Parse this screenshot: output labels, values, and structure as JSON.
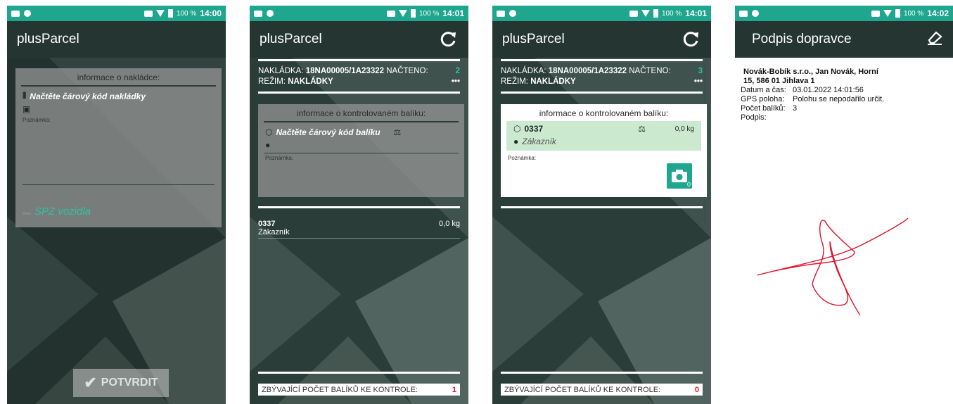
{
  "colors": {
    "accent": "#1fa68e",
    "dark": "#253632",
    "danger": "#e0132a"
  },
  "screens": [
    {
      "status": {
        "battery": "100 %",
        "time": "14:00"
      },
      "app_title": "plusParcel",
      "panel_heading": "informace o nakládce:",
      "scan_prompt": "Načtěte čárový kód nakládky",
      "note_label": "Poznámka:",
      "vehicle_placeholder": "SPZ vozidla",
      "confirm_label": "POTVRDIT",
      "icons": {
        "scan": "barcode-icon",
        "calendar": "calendar-icon",
        "truck": "truck-icon",
        "confirm": "check-icon"
      }
    },
    {
      "status": {
        "battery": "100 %",
        "time": "14:01"
      },
      "app_title": "plusParcel",
      "loading_label": "NAKLÁDKA:",
      "loading_code": "18NA00005/1A23322",
      "loaded_label": "NAČTENO:",
      "loaded_count": "2",
      "mode_label": "REŽIM:",
      "mode_value": "NAKLÁDKY",
      "more": "•••",
      "panel_heading": "informace o kontrolovaném balíku:",
      "scan_prompt": "Načtěte čárový kód balíku",
      "note_label": "Poznámka:",
      "list": [
        {
          "code": "0337",
          "weight": "0,0 kg",
          "customer": "Zákazník"
        }
      ],
      "remaining_label": "ZBÝVAJÍCÍ POČET BALÍKŮ KE KONTROLE:",
      "remaining_count": "1"
    },
    {
      "status": {
        "battery": "100 %",
        "time": "14:01"
      },
      "app_title": "plusParcel",
      "loading_label": "NAKLÁDKA:",
      "loading_code": "18NA00005/1A23322",
      "loaded_label": "NAČTENO:",
      "loaded_count": "3",
      "mode_label": "REŽIM:",
      "mode_value": "NAKLÁDKY",
      "more": "•••",
      "panel_heading": "informace o kontrolovaném balíku:",
      "package_code": "0337",
      "package_weight": "0,0 kg",
      "package_customer": "Zákazník",
      "note_label": "Poznámka:",
      "photo_count": "0",
      "remaining_label": "ZBÝVAJÍCÍ POČET BALÍKŮ KE KONTROLE:",
      "remaining_count": "0"
    },
    {
      "status": {
        "battery": "100 %",
        "time": "14:02"
      },
      "title": "Podpis dopravce",
      "carrier_line1": "Novák-Bobík s.r.o., Jan Novák, Horní",
      "carrier_line2": "15, 586 01 Jihlava 1",
      "date_label": "Datum a čas:",
      "date_value": "03.01.2022 14:01:56",
      "gps_label": "GPS poloha:",
      "gps_value": "Polohu se nepodařilo určit.",
      "count_label": "Počet balíků:",
      "count_value": "3",
      "signature_label": "Podpis:"
    }
  ]
}
